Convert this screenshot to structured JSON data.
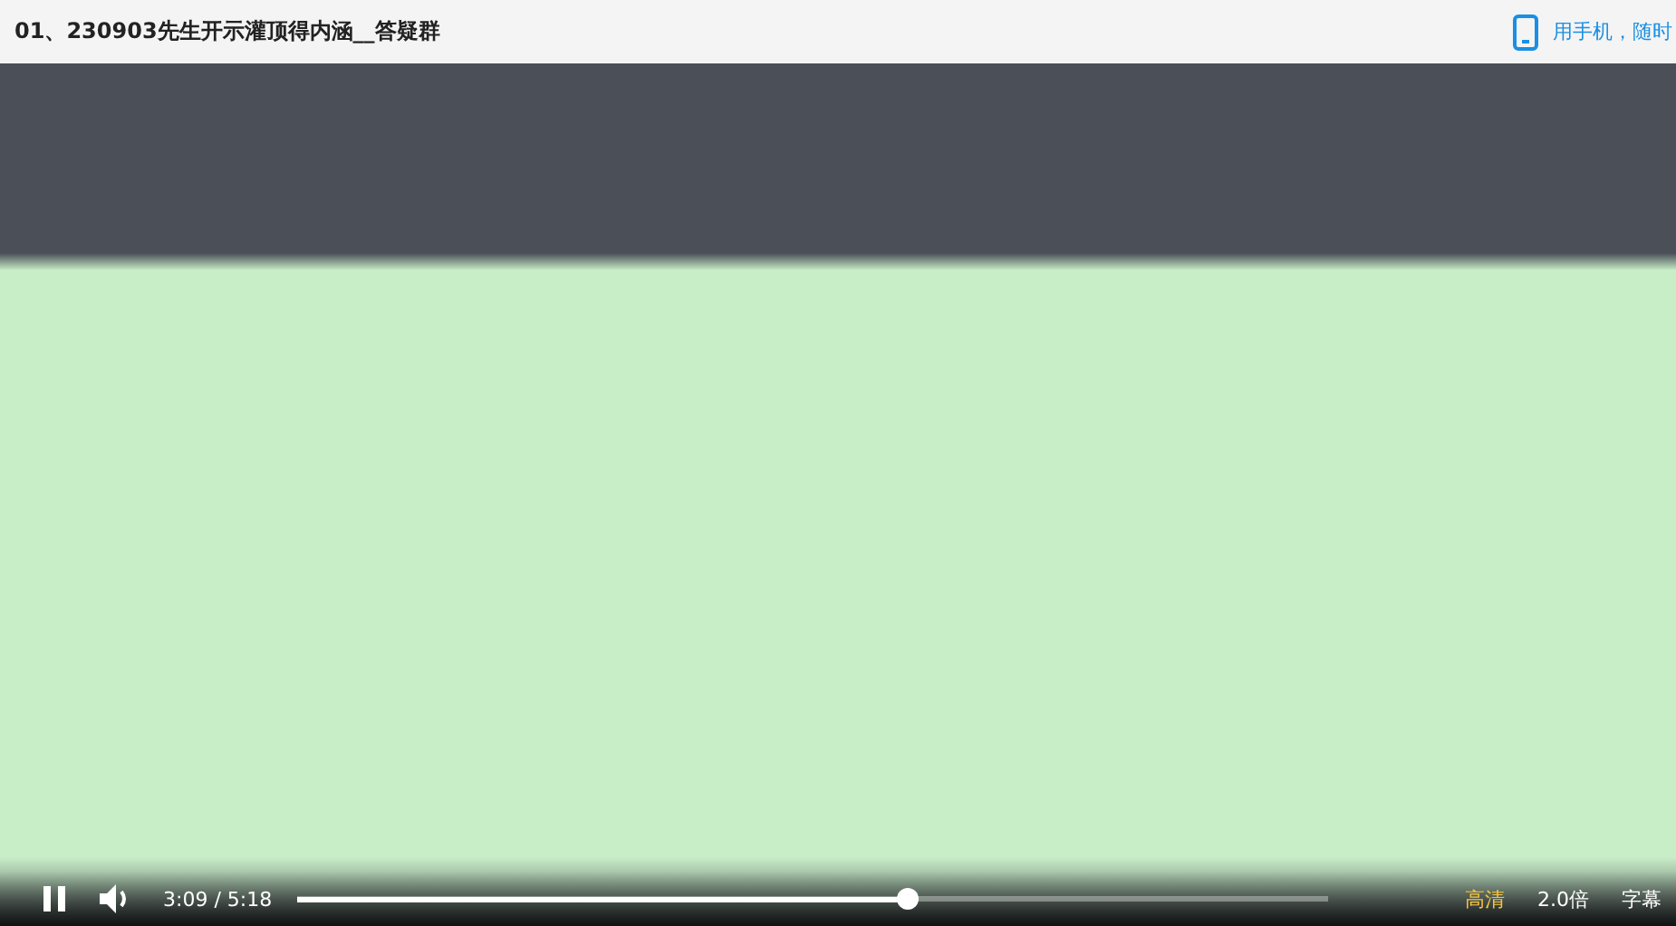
{
  "title": "01、230903先生开示灌顶得内涵__答疑群",
  "mobile_link": "用手机，随时",
  "player": {
    "playing": true,
    "time": "3:09 / 5:18",
    "progress": {
      "level": 0.594
    },
    "quality": "高清",
    "speed": "2.0倍",
    "subtitles": "字幕"
  }
}
